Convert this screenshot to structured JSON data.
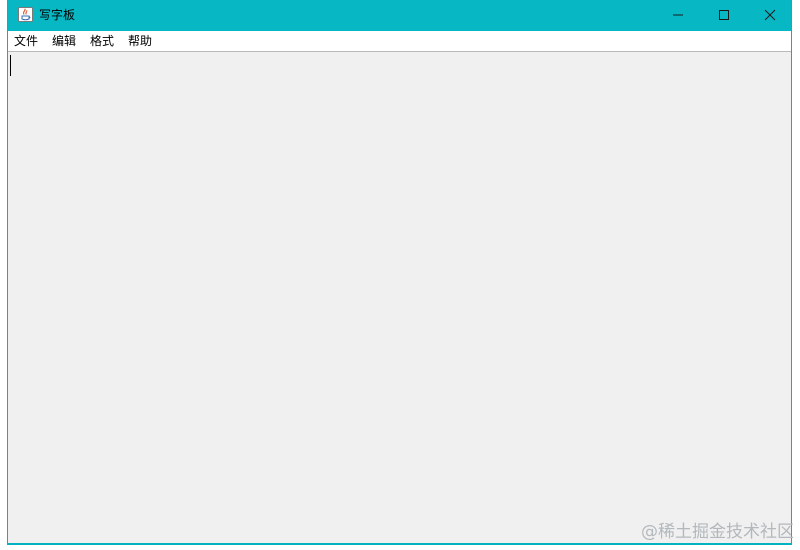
{
  "window": {
    "title": "写字板",
    "accent_color": "#07b8c4",
    "app_icon": "java-cup-icon",
    "controls": {
      "minimize_icon": "minimize-icon",
      "maximize_icon": "maximize-icon",
      "close_icon": "close-icon"
    }
  },
  "menubar": {
    "items": [
      {
        "label": "文件"
      },
      {
        "label": "编辑"
      },
      {
        "label": "格式"
      },
      {
        "label": "帮助"
      }
    ]
  },
  "editor": {
    "content": ""
  },
  "watermark": {
    "text": "@稀土掘金技术社区"
  }
}
